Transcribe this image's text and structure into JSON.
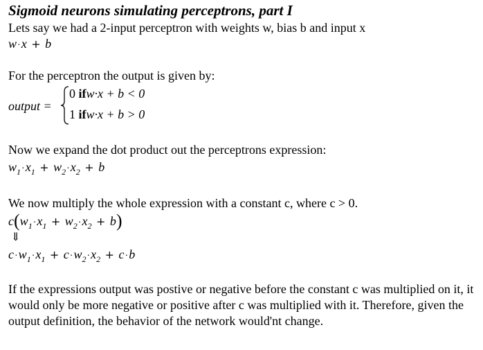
{
  "title": "Sigmoid neurons simulating perceptrons, part I",
  "intro": "Lets say we had a 2-input perceptron with weights w, bias b and input x",
  "expr1": {
    "w": "w",
    "dot": "·",
    "x": "x",
    "plus": "+",
    "b": "b"
  },
  "output_intro": "For the perceptron the output is given by:",
  "output_label": "output =",
  "cases": [
    {
      "value": "0",
      "if": "if",
      "cond": "w·x + b < 0"
    },
    {
      "value": "1",
      "if": "if",
      "cond": "w·x + b > 0"
    }
  ],
  "expand_intro": "Now we expand the dot product out the perceptrons expression:",
  "expr2": {
    "w": "w",
    "x": "x",
    "sub1": "1",
    "sub2": "2",
    "b": "b",
    "plus": "+",
    "dot": "·"
  },
  "multiply_intro": "We now multiply the whole expression with a constant c, where c > 0.",
  "expr3": {
    "c": "c",
    "lparen": "(",
    "rparen": ")"
  },
  "implies": "⇓",
  "conclusion": "If the expressions output was postive or negative before the constant c was multiplied on it, it would only be more negative or positive after c was multiplied with it. Therefore, given the output definition, the behavior of the network would'nt change."
}
